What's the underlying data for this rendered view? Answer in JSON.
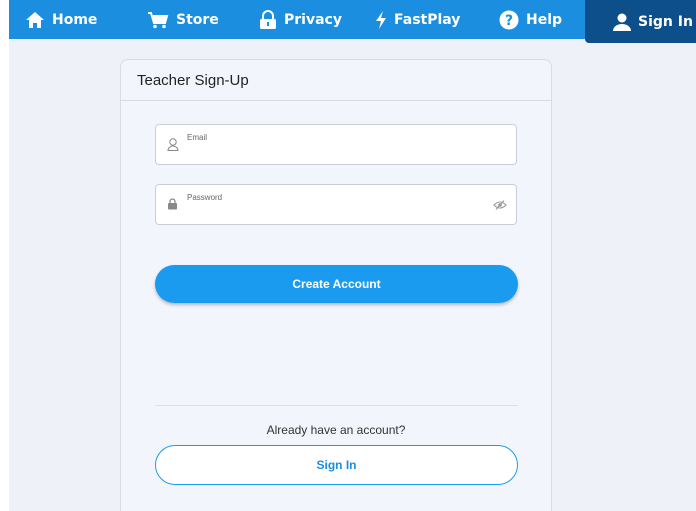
{
  "nav": {
    "items": [
      {
        "label": "Home",
        "icon": "home-icon"
      },
      {
        "label": "Store",
        "icon": "cart-icon"
      },
      {
        "label": "Privacy",
        "icon": "lock-icon"
      },
      {
        "label": "FastPlay",
        "icon": "lightning-icon"
      },
      {
        "label": "Help",
        "icon": "help-icon"
      }
    ],
    "signin": {
      "label": "Sign In",
      "icon": "user-icon"
    }
  },
  "card": {
    "title": "Teacher Sign-Up",
    "email": {
      "label": "Email",
      "value": ""
    },
    "password": {
      "label": "Password",
      "value": ""
    },
    "create_label": "Create Account",
    "already_text": "Already have an account?",
    "signin_label": "Sign In"
  },
  "colors": {
    "nav": "#1b8ee0",
    "nav_active": "#0d4f8a",
    "primary": "#1b9bf0",
    "card_bg": "#f2f5fb"
  }
}
